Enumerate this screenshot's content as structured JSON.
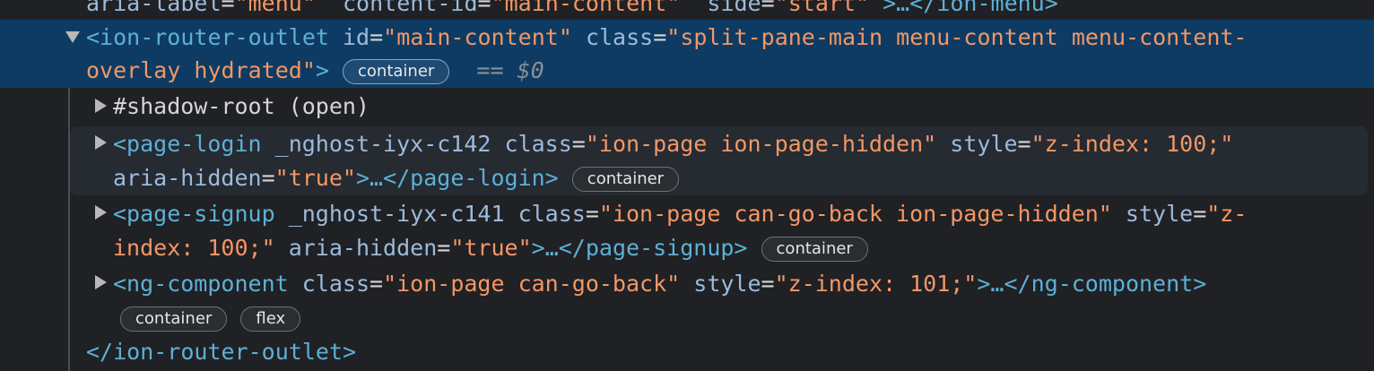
{
  "top_partial": {
    "attr1_name": "aria-label",
    "attr1_value": "\"menu\"",
    "attr2_name": "content-id",
    "attr2_value": "\"main-content\"",
    "attr3_name": "side",
    "attr3_value": "\"start\"",
    "collapsed": ">…</ion-menu>"
  },
  "router_outlet": {
    "open_tag": "<ion-router-outlet",
    "id_name": "id",
    "id_value": "\"main-content\"",
    "class_name": "class",
    "class_value_line1": "\"split-pane-main menu-content menu-content-",
    "class_value_line2": "overlay hydrated\"",
    "close_bracket": ">",
    "badge": "container",
    "eq_dollar": "== $0",
    "close_tag": "</ion-router-outlet>"
  },
  "shadow_root": {
    "label": "#shadow-root (open)"
  },
  "page_login": {
    "open_tag": "<page-login",
    "ng_attr": "_nghost-iyx-c142",
    "class_name": "class",
    "class_value": "\"ion-page ion-page-hidden\"",
    "style_name": "style",
    "style_value": "\"z-index: 100;\"",
    "aria_name": "aria-hidden",
    "aria_value": "\"true\"",
    "collapsed": ">…",
    "close_tag": "</page-login>",
    "badge": "container"
  },
  "page_signup": {
    "open_tag": "<page-signup",
    "ng_attr": "_nghost-iyx-c141",
    "class_name": "class",
    "class_value": "\"ion-page can-go-back ion-page-hidden\"",
    "style_name": "style",
    "style_value_line1": "\"z-",
    "style_value_line2": "index: 100;\"",
    "aria_name": "aria-hidden",
    "aria_value": "\"true\"",
    "collapsed": ">…",
    "close_tag": "</page-signup>",
    "badge": "container"
  },
  "ng_component": {
    "open_tag": "<ng-component",
    "class_name": "class",
    "class_value": "\"ion-page can-go-back\"",
    "style_name": "style",
    "style_value": "\"z-index: 101;\"",
    "collapsed": ">…",
    "close_tag": "</ng-component>",
    "badge1": "container",
    "badge2": "flex"
  },
  "colors": {
    "tag": "#5db0d7",
    "attribute": "#9bbbdc",
    "value": "#f29766",
    "selection": "#0e3b63",
    "background": "#202124"
  }
}
